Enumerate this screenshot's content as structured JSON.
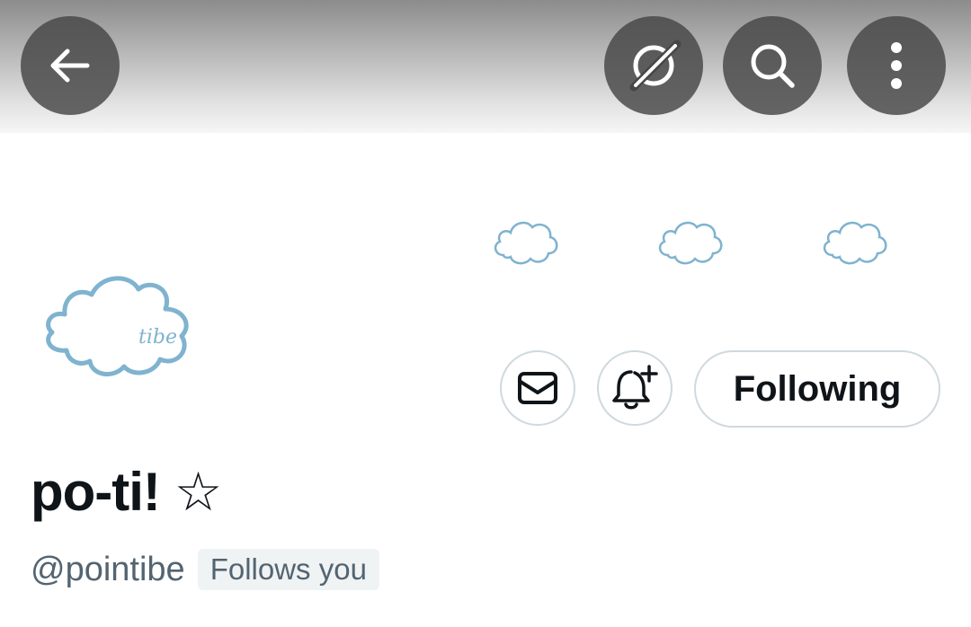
{
  "profile": {
    "display_name": "po-ti! ☆",
    "handle": "@pointibe",
    "follows_you_label": "Follows you",
    "avatar_text": "tibe"
  },
  "actions": {
    "following_label": "Following"
  },
  "icons": {
    "back": "back-arrow-icon",
    "grok": "grok-icon",
    "search": "search-icon",
    "more": "more-vertical-icon",
    "message": "envelope-icon",
    "notify": "bell-plus-icon"
  },
  "colors": {
    "cloud_outline": "#7fb3cf",
    "text_primary": "#0f1419",
    "text_secondary": "#536471",
    "button_border": "#cfd9de"
  }
}
